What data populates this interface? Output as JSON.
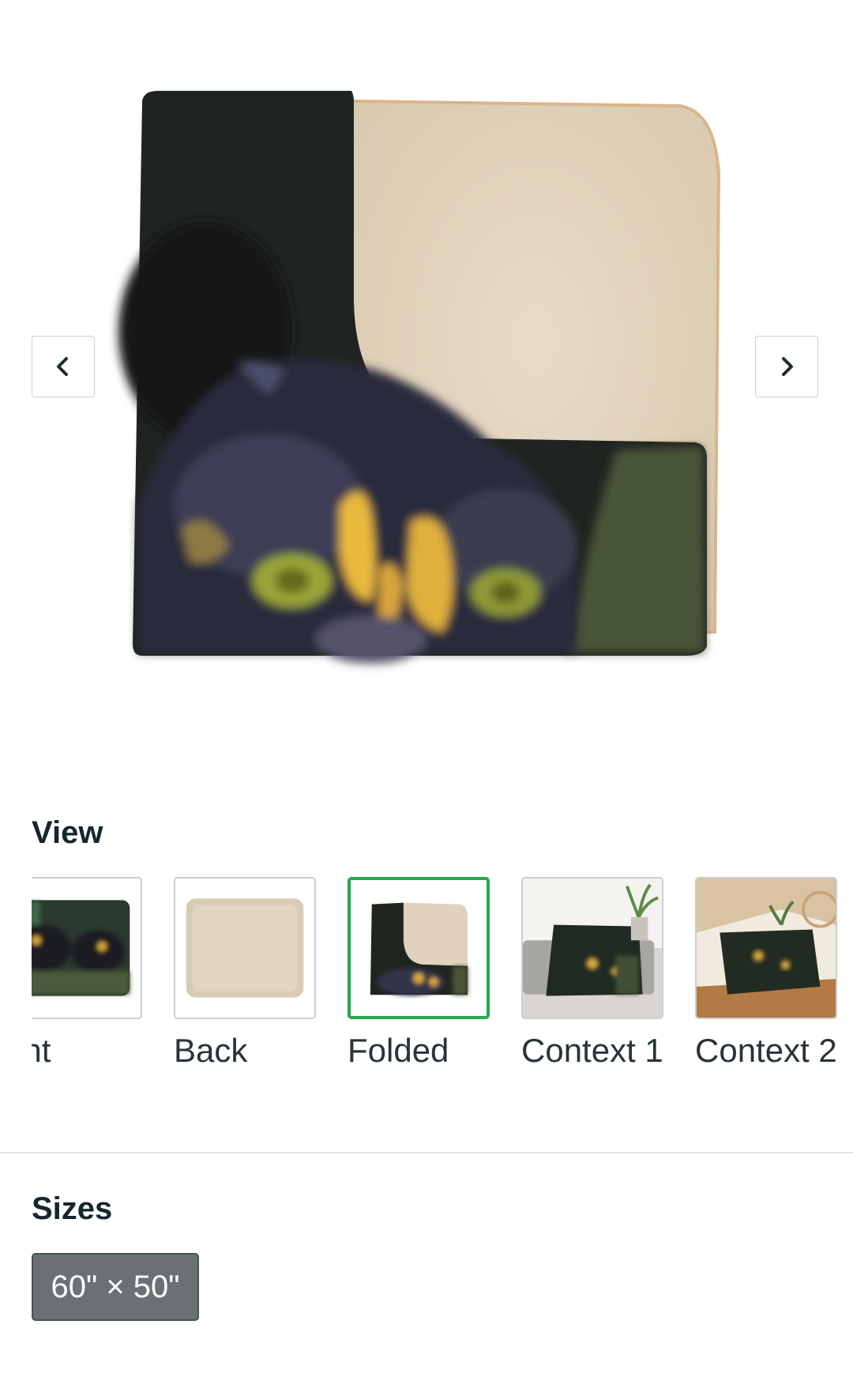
{
  "gallery": {
    "main_image_alt": "Folded blanket",
    "prev_icon": "chevron-left-icon",
    "next_icon": "chevron-right-icon"
  },
  "views": {
    "title": "View",
    "items": [
      {
        "label": "Front",
        "visible_text": "ront",
        "selected": false
      },
      {
        "label": "Back",
        "selected": false
      },
      {
        "label": "Folded",
        "selected": true
      },
      {
        "label": "Context 1",
        "selected": false
      },
      {
        "label": "Context 2",
        "selected": false
      }
    ]
  },
  "sizes": {
    "title": "Sizes",
    "options": [
      "60\" × 50\""
    ],
    "selected": "60\" × 50\""
  },
  "colors": {
    "selected_border": "#2ba84a",
    "size_button_bg": "#6b7173",
    "fleece": "#e1d3bd"
  }
}
